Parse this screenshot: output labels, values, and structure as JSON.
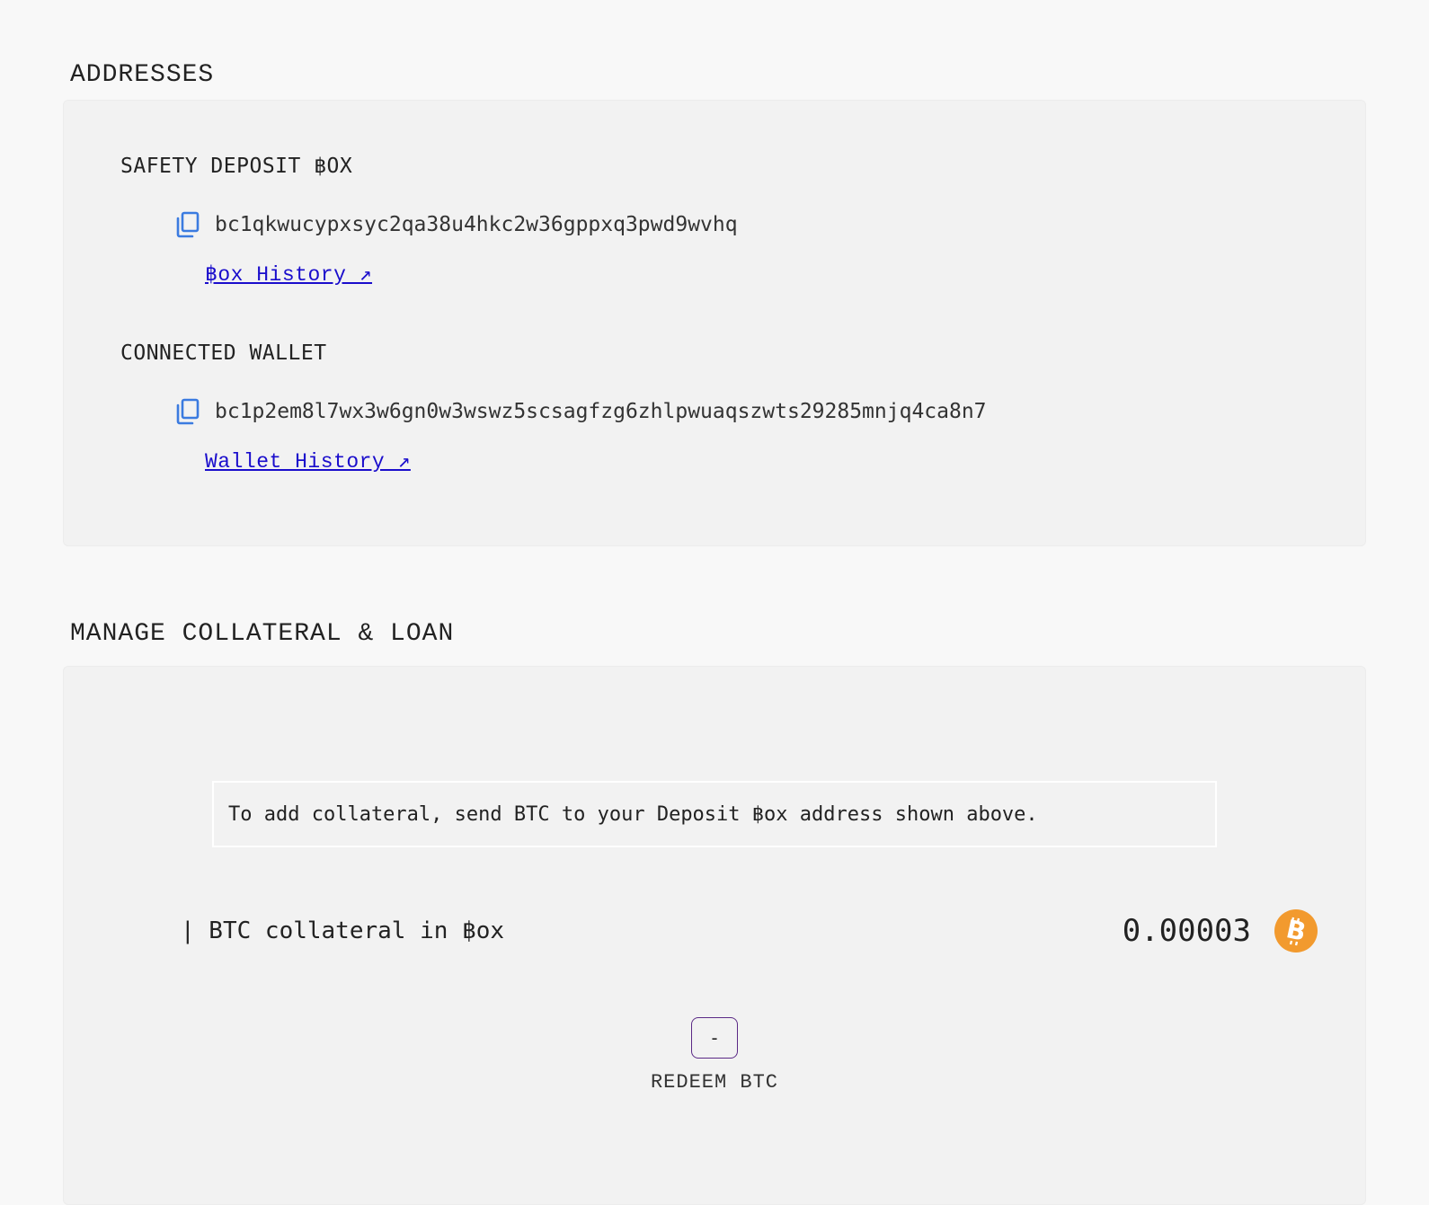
{
  "addresses": {
    "title": "ADDRESSES",
    "deposit_box": {
      "label": "SAFETY DEPOSIT ฿OX",
      "address": "bc1qkwucypxsyc2qa38u4hkc2w36gppxq3pwd9wvhq",
      "history_link": "฿ox History ↗",
      "copy_icon": "copy-icon"
    },
    "wallet": {
      "label": "CONNECTED WALLET",
      "address": "bc1p2em8l7wx3w6gn0w3wswz5scsagfzg6zhlpwuaqszwts29285mnjq4ca8n7",
      "history_link": "Wallet History ↗",
      "copy_icon": "copy-icon"
    }
  },
  "manage": {
    "title": "MANAGE COLLATERAL & LOAN",
    "info_text": "To add collateral, send BTC to your Deposit ฿ox address shown above.",
    "collateral_label": "| BTC collateral in ฿ox",
    "collateral_amount": "0.00003",
    "currency_icon": "bitcoin-icon",
    "redeem_button": "-",
    "redeem_label": "REDEEM BTC"
  },
  "colors": {
    "link": "#1a0dcc",
    "copy_icon": "#3b7be0",
    "bitcoin": "#f7931a",
    "button_border": "#5b2a86"
  }
}
